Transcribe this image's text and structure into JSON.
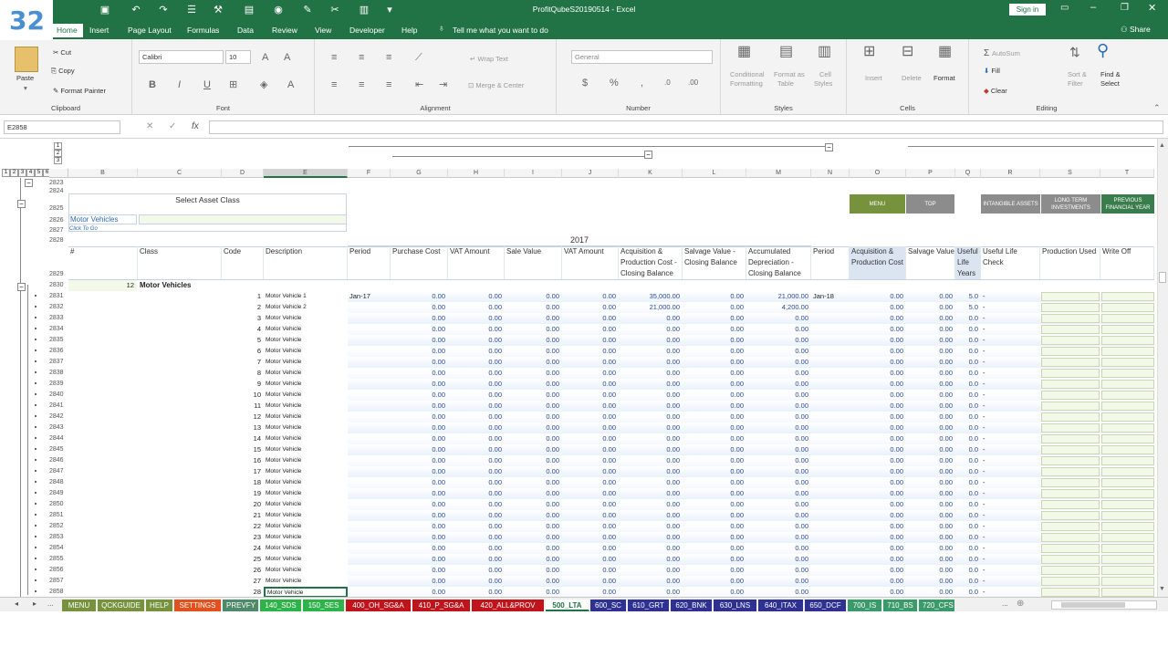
{
  "badge": "32",
  "window": {
    "title": "ProfitQubeS20190514  -  Excel",
    "signin": "Sign in",
    "share": "Share",
    "quick_access": [
      "save-icon",
      "undo-icon",
      "redo-icon",
      "form-icon",
      "wand-icon",
      "document-icon",
      "camera-icon",
      "brush-icon",
      "cut-icon",
      "paste-icon",
      "dropdown-icon"
    ]
  },
  "ribbon_tabs": [
    "Home",
    "Insert",
    "Page Layout",
    "Formulas",
    "Data",
    "Review",
    "View",
    "Developer",
    "Help"
  ],
  "tell_me": "Tell me what you want to do",
  "clipboard": {
    "paste": "Paste",
    "cut": "Cut",
    "copy": "Copy",
    "format_painter": "Format Painter",
    "label": "Clipboard"
  },
  "font": {
    "name": "Calibri",
    "size": "10",
    "label": "Font"
  },
  "alignment": {
    "wrap": "Wrap Text",
    "merge": "Merge & Center",
    "label": "Alignment"
  },
  "number": {
    "format": "General",
    "label": "Number"
  },
  "styles": {
    "conditional": "Conditional",
    "conditional2": "Formatting",
    "format_as": "Format as",
    "format_as2": "Table",
    "cell": "Cell",
    "cell2": "Styles",
    "label": "Styles"
  },
  "cells": {
    "insert": "Insert",
    "delete": "Delete",
    "format": "Format",
    "label": "Cells"
  },
  "editing": {
    "autosum": "AutoSum",
    "fill": "Fill",
    "clear": "Clear",
    "sort": "Sort &",
    "sort2": "Filter",
    "find": "Find &",
    "find2": "Select",
    "label": "Editing"
  },
  "formula_bar": {
    "name_box": "E2858",
    "formula": ""
  },
  "outline_levels": [
    "1",
    "2",
    "3",
    "4",
    "5",
    "6"
  ],
  "col_outline_levels": [
    "1",
    "2",
    "3"
  ],
  "columns": [
    "B",
    "C",
    "D",
    "E",
    "F",
    "G",
    "H",
    "I",
    "J",
    "K",
    "L",
    "M",
    "N",
    "O",
    "P",
    "Q",
    "R",
    "S",
    "T"
  ],
  "sheet": {
    "select_asset_class": "Select Asset Class",
    "selected_class": "Motor Vehicles",
    "click_to_go": "Click To Go",
    "year": "2017",
    "buttons": {
      "menu": "MENU",
      "top": "TOP",
      "intangible": "INTANGIBLE ASSETS",
      "long_term": "LONG TERM INVESTMENTS",
      "previous": "PREVIOUS FINANCIAL YEAR"
    },
    "headers": {
      "num": "#",
      "class": "Class",
      "code": "Code",
      "description": "Description",
      "period": "Period",
      "purchase_cost": "Purchase Cost",
      "vat_amount": "VAT Amount",
      "sale_value": "Sale Value",
      "vat_amount2": "VAT Amount",
      "acq_cost": "Acquisition & Production Cost - Closing Balance",
      "salvage_closing": "Salvage Value - Closing Balance",
      "acc_dep": "Accumulated Depreciation - Closing Balance",
      "period2": "Period",
      "acq2": "Acquisition & Production Cost",
      "salvage2": "Salvage Value",
      "useful_life": "Useful Life Years",
      "useful_check": "Useful Life Check",
      "production_used": "Production Used",
      "write_off": "Write Off"
    },
    "section": {
      "count": "12",
      "title": "Motor Vehicles"
    },
    "row_numbers_top": [
      "2823",
      "2824",
      "2825",
      "2826",
      "2827",
      "2828",
      "2829",
      "2830"
    ],
    "rows": [
      {
        "row": "2831",
        "code": "1",
        "desc": "Motor Vehicle 1",
        "period": "Jan-17",
        "pc": "0.00",
        "vat": "0.00",
        "sale": "0.00",
        "vat2": "0.00",
        "acq": "35,000.00",
        "salv": "0.00",
        "dep": "21,000.00",
        "period2": "Jan-18",
        "acq2": "0.00",
        "salv2": "0.00",
        "life": "5.0",
        "check": "-"
      },
      {
        "row": "2832",
        "code": "2",
        "desc": "Motor Vehicle 2",
        "period": "",
        "pc": "0.00",
        "vat": "0.00",
        "sale": "0.00",
        "vat2": "0.00",
        "acq": "21,000.00",
        "salv": "0.00",
        "dep": "4,200.00",
        "period2": "",
        "acq2": "0.00",
        "salv2": "0.00",
        "life": "5.0",
        "check": "-"
      },
      {
        "row": "2833",
        "code": "3",
        "desc": "Motor Vehicle",
        "period": "",
        "pc": "0.00",
        "vat": "0.00",
        "sale": "0.00",
        "vat2": "0.00",
        "acq": "0.00",
        "salv": "0.00",
        "dep": "0.00",
        "period2": "",
        "acq2": "0.00",
        "salv2": "0.00",
        "life": "0.0",
        "check": "-"
      },
      {
        "row": "2834",
        "code": "4",
        "desc": "Motor Vehicle",
        "period": "",
        "pc": "0.00",
        "vat": "0.00",
        "sale": "0.00",
        "vat2": "0.00",
        "acq": "0.00",
        "salv": "0.00",
        "dep": "0.00",
        "period2": "",
        "acq2": "0.00",
        "salv2": "0.00",
        "life": "0.0",
        "check": "-"
      },
      {
        "row": "2835",
        "code": "5",
        "desc": "Motor Vehicle",
        "period": "",
        "pc": "0.00",
        "vat": "0.00",
        "sale": "0.00",
        "vat2": "0.00",
        "acq": "0.00",
        "salv": "0.00",
        "dep": "0.00",
        "period2": "",
        "acq2": "0.00",
        "salv2": "0.00",
        "life": "0.0",
        "check": "-"
      },
      {
        "row": "2836",
        "code": "6",
        "desc": "Motor Vehicle",
        "period": "",
        "pc": "0.00",
        "vat": "0.00",
        "sale": "0.00",
        "vat2": "0.00",
        "acq": "0.00",
        "salv": "0.00",
        "dep": "0.00",
        "period2": "",
        "acq2": "0.00",
        "salv2": "0.00",
        "life": "0.0",
        "check": "-"
      },
      {
        "row": "2837",
        "code": "7",
        "desc": "Motor Vehicle",
        "period": "",
        "pc": "0.00",
        "vat": "0.00",
        "sale": "0.00",
        "vat2": "0.00",
        "acq": "0.00",
        "salv": "0.00",
        "dep": "0.00",
        "period2": "",
        "acq2": "0.00",
        "salv2": "0.00",
        "life": "0.0",
        "check": "-"
      },
      {
        "row": "2838",
        "code": "8",
        "desc": "Motor Vehicle",
        "period": "",
        "pc": "0.00",
        "vat": "0.00",
        "sale": "0.00",
        "vat2": "0.00",
        "acq": "0.00",
        "salv": "0.00",
        "dep": "0.00",
        "period2": "",
        "acq2": "0.00",
        "salv2": "0.00",
        "life": "0.0",
        "check": "-"
      },
      {
        "row": "2839",
        "code": "9",
        "desc": "Motor Vehicle",
        "period": "",
        "pc": "0.00",
        "vat": "0.00",
        "sale": "0.00",
        "vat2": "0.00",
        "acq": "0.00",
        "salv": "0.00",
        "dep": "0.00",
        "period2": "",
        "acq2": "0.00",
        "salv2": "0.00",
        "life": "0.0",
        "check": "-"
      },
      {
        "row": "2840",
        "code": "10",
        "desc": "Motor Vehicle",
        "period": "",
        "pc": "0.00",
        "vat": "0.00",
        "sale": "0.00",
        "vat2": "0.00",
        "acq": "0.00",
        "salv": "0.00",
        "dep": "0.00",
        "period2": "",
        "acq2": "0.00",
        "salv2": "0.00",
        "life": "0.0",
        "check": "-"
      },
      {
        "row": "2841",
        "code": "11",
        "desc": "Motor Vehicle",
        "period": "",
        "pc": "0.00",
        "vat": "0.00",
        "sale": "0.00",
        "vat2": "0.00",
        "acq": "0.00",
        "salv": "0.00",
        "dep": "0.00",
        "period2": "",
        "acq2": "0.00",
        "salv2": "0.00",
        "life": "0.0",
        "check": "-"
      },
      {
        "row": "2842",
        "code": "12",
        "desc": "Motor Vehicle",
        "period": "",
        "pc": "0.00",
        "vat": "0.00",
        "sale": "0.00",
        "vat2": "0.00",
        "acq": "0.00",
        "salv": "0.00",
        "dep": "0.00",
        "period2": "",
        "acq2": "0.00",
        "salv2": "0.00",
        "life": "0.0",
        "check": "-"
      },
      {
        "row": "2843",
        "code": "13",
        "desc": "Motor Vehicle",
        "period": "",
        "pc": "0.00",
        "vat": "0.00",
        "sale": "0.00",
        "vat2": "0.00",
        "acq": "0.00",
        "salv": "0.00",
        "dep": "0.00",
        "period2": "",
        "acq2": "0.00",
        "salv2": "0.00",
        "life": "0.0",
        "check": "-"
      },
      {
        "row": "2844",
        "code": "14",
        "desc": "Motor Vehicle",
        "period": "",
        "pc": "0.00",
        "vat": "0.00",
        "sale": "0.00",
        "vat2": "0.00",
        "acq": "0.00",
        "salv": "0.00",
        "dep": "0.00",
        "period2": "",
        "acq2": "0.00",
        "salv2": "0.00",
        "life": "0.0",
        "check": "-"
      },
      {
        "row": "2845",
        "code": "15",
        "desc": "Motor Vehicle",
        "period": "",
        "pc": "0.00",
        "vat": "0.00",
        "sale": "0.00",
        "vat2": "0.00",
        "acq": "0.00",
        "salv": "0.00",
        "dep": "0.00",
        "period2": "",
        "acq2": "0.00",
        "salv2": "0.00",
        "life": "0.0",
        "check": "-"
      },
      {
        "row": "2846",
        "code": "16",
        "desc": "Motor Vehicle",
        "period": "",
        "pc": "0.00",
        "vat": "0.00",
        "sale": "0.00",
        "vat2": "0.00",
        "acq": "0.00",
        "salv": "0.00",
        "dep": "0.00",
        "period2": "",
        "acq2": "0.00",
        "salv2": "0.00",
        "life": "0.0",
        "check": "-"
      },
      {
        "row": "2847",
        "code": "17",
        "desc": "Motor Vehicle",
        "period": "",
        "pc": "0.00",
        "vat": "0.00",
        "sale": "0.00",
        "vat2": "0.00",
        "acq": "0.00",
        "salv": "0.00",
        "dep": "0.00",
        "period2": "",
        "acq2": "0.00",
        "salv2": "0.00",
        "life": "0.0",
        "check": "-"
      },
      {
        "row": "2848",
        "code": "18",
        "desc": "Motor Vehicle",
        "period": "",
        "pc": "0.00",
        "vat": "0.00",
        "sale": "0.00",
        "vat2": "0.00",
        "acq": "0.00",
        "salv": "0.00",
        "dep": "0.00",
        "period2": "",
        "acq2": "0.00",
        "salv2": "0.00",
        "life": "0.0",
        "check": "-"
      },
      {
        "row": "2849",
        "code": "19",
        "desc": "Motor Vehicle",
        "period": "",
        "pc": "0.00",
        "vat": "0.00",
        "sale": "0.00",
        "vat2": "0.00",
        "acq": "0.00",
        "salv": "0.00",
        "dep": "0.00",
        "period2": "",
        "acq2": "0.00",
        "salv2": "0.00",
        "life": "0.0",
        "check": "-"
      },
      {
        "row": "2850",
        "code": "20",
        "desc": "Motor Vehicle",
        "period": "",
        "pc": "0.00",
        "vat": "0.00",
        "sale": "0.00",
        "vat2": "0.00",
        "acq": "0.00",
        "salv": "0.00",
        "dep": "0.00",
        "period2": "",
        "acq2": "0.00",
        "salv2": "0.00",
        "life": "0.0",
        "check": "-"
      },
      {
        "row": "2851",
        "code": "21",
        "desc": "Motor Vehicle",
        "period": "",
        "pc": "0.00",
        "vat": "0.00",
        "sale": "0.00",
        "vat2": "0.00",
        "acq": "0.00",
        "salv": "0.00",
        "dep": "0.00",
        "period2": "",
        "acq2": "0.00",
        "salv2": "0.00",
        "life": "0.0",
        "check": "-"
      },
      {
        "row": "2852",
        "code": "22",
        "desc": "Motor Vehicle",
        "period": "",
        "pc": "0.00",
        "vat": "0.00",
        "sale": "0.00",
        "vat2": "0.00",
        "acq": "0.00",
        "salv": "0.00",
        "dep": "0.00",
        "period2": "",
        "acq2": "0.00",
        "salv2": "0.00",
        "life": "0.0",
        "check": "-"
      },
      {
        "row": "2853",
        "code": "23",
        "desc": "Motor Vehicle",
        "period": "",
        "pc": "0.00",
        "vat": "0.00",
        "sale": "0.00",
        "vat2": "0.00",
        "acq": "0.00",
        "salv": "0.00",
        "dep": "0.00",
        "period2": "",
        "acq2": "0.00",
        "salv2": "0.00",
        "life": "0.0",
        "check": "-"
      },
      {
        "row": "2854",
        "code": "24",
        "desc": "Motor Vehicle",
        "period": "",
        "pc": "0.00",
        "vat": "0.00",
        "sale": "0.00",
        "vat2": "0.00",
        "acq": "0.00",
        "salv": "0.00",
        "dep": "0.00",
        "period2": "",
        "acq2": "0.00",
        "salv2": "0.00",
        "life": "0.0",
        "check": "-"
      },
      {
        "row": "2855",
        "code": "25",
        "desc": "Motor Vehicle",
        "period": "",
        "pc": "0.00",
        "vat": "0.00",
        "sale": "0.00",
        "vat2": "0.00",
        "acq": "0.00",
        "salv": "0.00",
        "dep": "0.00",
        "period2": "",
        "acq2": "0.00",
        "salv2": "0.00",
        "life": "0.0",
        "check": "-"
      },
      {
        "row": "2856",
        "code": "26",
        "desc": "Motor Vehicle",
        "period": "",
        "pc": "0.00",
        "vat": "0.00",
        "sale": "0.00",
        "vat2": "0.00",
        "acq": "0.00",
        "salv": "0.00",
        "dep": "0.00",
        "period2": "",
        "acq2": "0.00",
        "salv2": "0.00",
        "life": "0.0",
        "check": "-"
      },
      {
        "row": "2857",
        "code": "27",
        "desc": "Motor Vehicle",
        "period": "",
        "pc": "0.00",
        "vat": "0.00",
        "sale": "0.00",
        "vat2": "0.00",
        "acq": "0.00",
        "salv": "0.00",
        "dep": "0.00",
        "period2": "",
        "acq2": "0.00",
        "salv2": "0.00",
        "life": "0.0",
        "check": "-"
      },
      {
        "row": "2858",
        "code": "28",
        "desc": "Motor Vehicle",
        "period": "",
        "pc": "0.00",
        "vat": "0.00",
        "sale": "0.00",
        "vat2": "0.00",
        "acq": "0.00",
        "salv": "0.00",
        "dep": "0.00",
        "period2": "",
        "acq2": "0.00",
        "salv2": "0.00",
        "life": "0.0",
        "check": "-"
      }
    ]
  },
  "sheet_tabs": [
    {
      "label": "MENU",
      "color": "#76923c"
    },
    {
      "label": "QCKGUIDE",
      "color": "#76923c"
    },
    {
      "label": "HELP",
      "color": "#76923c"
    },
    {
      "label": "SETTINGS",
      "color": "#e2501c"
    },
    {
      "label": "PREVFY",
      "color": "#4e8a6a"
    },
    {
      "label": "140_SDS",
      "color": "#2db34a"
    },
    {
      "label": "150_SES",
      "color": "#2db34a"
    },
    {
      "label": "400_OH_SG&A",
      "color": "#c0141c"
    },
    {
      "label": "410_P_SG&A",
      "color": "#c0141c"
    },
    {
      "label": "420_ALL&PROV",
      "color": "#c0141c"
    },
    {
      "label": "500_LTA",
      "color": "#ffffff",
      "active": true
    },
    {
      "label": "600_SC",
      "color": "#2e3192"
    },
    {
      "label": "610_GRT",
      "color": "#2e3192"
    },
    {
      "label": "620_BNK",
      "color": "#2e3192"
    },
    {
      "label": "630_LNS",
      "color": "#2e3192"
    },
    {
      "label": "640_ITAX",
      "color": "#2e3192"
    },
    {
      "label": "650_DCF",
      "color": "#2e3192"
    },
    {
      "label": "700_IS",
      "color": "#3a9a6a"
    },
    {
      "label": "710_BS",
      "color": "#3a9a6a"
    },
    {
      "label": "720_CFS",
      "color": "#3a9a6a"
    }
  ],
  "sheet_nav": {
    "ellipsis_left": "...",
    "ellipsis_right": "..."
  }
}
